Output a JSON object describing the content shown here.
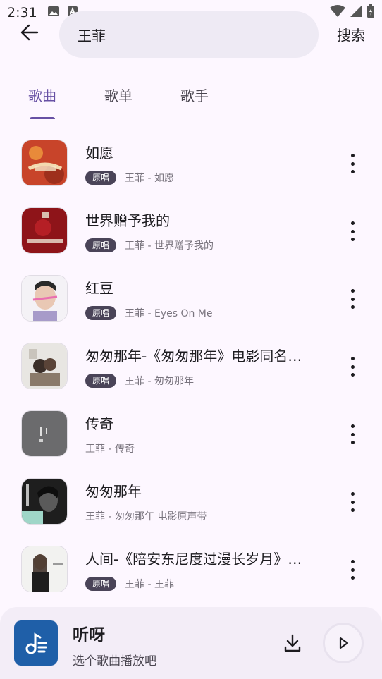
{
  "status_bar": {
    "time": "2:31"
  },
  "search": {
    "query": "王菲",
    "search_label": "搜索"
  },
  "tabs": [
    {
      "label": "歌曲",
      "active": true
    },
    {
      "label": "歌单",
      "active": false
    },
    {
      "label": "歌手",
      "active": false
    }
  ],
  "songs": [
    {
      "title": "如愿",
      "badge": "原唱",
      "subtitle": "王菲 - 如愿"
    },
    {
      "title": "世界赠予我的",
      "badge": "原唱",
      "subtitle": "王菲 - 世界赠予我的"
    },
    {
      "title": "红豆",
      "badge": "原唱",
      "subtitle": "王菲 - Eyes On Me"
    },
    {
      "title": "匆匆那年-《匆匆那年》电影同名…",
      "badge": "原唱",
      "subtitle": "王菲 - 匆匆那年"
    },
    {
      "title": "传奇",
      "badge": "",
      "subtitle": "王菲 - 传奇"
    },
    {
      "title": "匆匆那年",
      "badge": "",
      "subtitle": "王菲 - 匆匆那年 电影原声带"
    },
    {
      "title": "人间-《陪安东尼度过漫长岁月》…",
      "badge": "原唱",
      "subtitle": "王菲 - 王菲"
    }
  ],
  "player": {
    "title": "听呀",
    "subtitle": "选个歌曲播放吧"
  },
  "colors": {
    "accent": "#6750A4",
    "badge": "#4A4458",
    "player_cover": "#1F5FA8"
  }
}
